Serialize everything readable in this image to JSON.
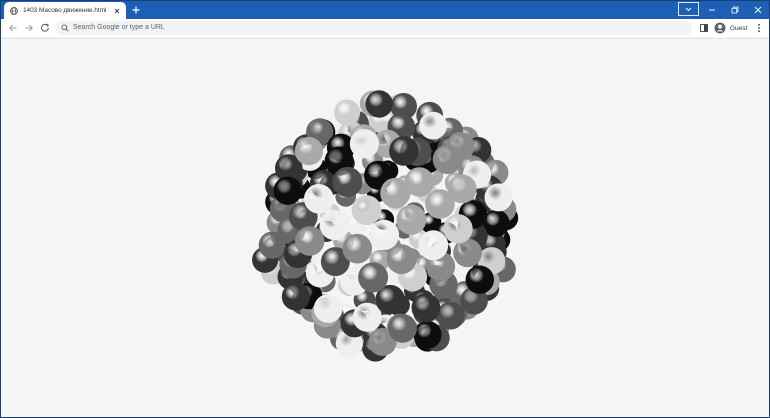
{
  "browser": {
    "tab_title": "1403 Масово движение.html",
    "omnibox_placeholder": "Search Google or type a URL",
    "profile_label": "Guest"
  },
  "scene": {
    "description_shade_levels": [
      "#0d0d0d",
      "#333333",
      "#4d4d4d",
      "#676767",
      "#8a8a8a",
      "#a9a9a9",
      "#cfcfcf",
      "#efefef"
    ]
  },
  "colors": {
    "titlebar": "#1d5fb4",
    "tab_background": "#ffffff",
    "page_background": "#f5f5f5"
  }
}
